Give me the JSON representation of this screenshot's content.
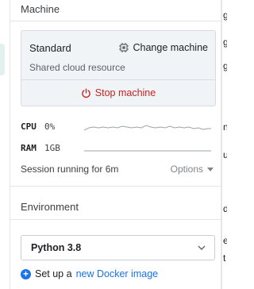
{
  "machine_section": {
    "title": "Machine",
    "card": {
      "name": "Standard",
      "description": "Shared cloud resource",
      "change_label": "Change machine",
      "stop_label": "Stop machine"
    }
  },
  "metrics": {
    "cpu": {
      "label": "CPU",
      "value": "0%"
    },
    "ram": {
      "label": "RAM",
      "value": "1GB"
    }
  },
  "session": {
    "text": "Session running for 6m",
    "options_label": "Options"
  },
  "environment": {
    "title": "Environment",
    "selected": "Python 3.8",
    "docker_prefix": "Set up a",
    "docker_link": "new Docker image"
  },
  "right_edge_glyphs": [
    "g",
    "g",
    "g",
    "n",
    "u",
    "d",
    "e",
    "t"
  ],
  "colors": {
    "accent": "#1a73e8",
    "danger": "#c5221f",
    "card_bg": "#f1f4f7",
    "border": "#d7dde3"
  }
}
